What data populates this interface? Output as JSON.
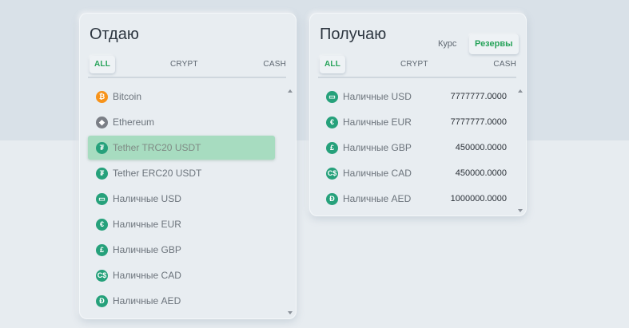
{
  "give": {
    "title": "Отдаю",
    "tabs": {
      "all": "ALL",
      "crypt": "CRYPT",
      "cash": "CASH"
    },
    "items": [
      {
        "label": "Bitcoin",
        "icon": "bitcoin-icon",
        "glyph": "₿",
        "color": "#f7931a"
      },
      {
        "label": "Ethereum",
        "icon": "ethereum-icon",
        "glyph": "◆",
        "color": "#7b7f86"
      },
      {
        "label": "Tether TRC20 USDT",
        "icon": "tether-icon",
        "glyph": "₮",
        "color": "#26a17b"
      },
      {
        "label": "Tether ERC20 USDT",
        "icon": "tether-icon",
        "glyph": "₮",
        "color": "#26a17b"
      },
      {
        "label": "Наличные USD",
        "icon": "cash-usd-icon",
        "glyph": "▭",
        "color": "#26a17b"
      },
      {
        "label": "Наличные EUR",
        "icon": "cash-eur-icon",
        "glyph": "€",
        "color": "#26a17b"
      },
      {
        "label": "Наличные GBP",
        "icon": "cash-gbp-icon",
        "glyph": "£",
        "color": "#26a17b"
      },
      {
        "label": "Наличные CAD",
        "icon": "cash-cad-icon",
        "glyph": "C$",
        "color": "#26a17b"
      },
      {
        "label": "Наличные AED",
        "icon": "cash-aed-icon",
        "glyph": "Đ",
        "color": "#26a17b"
      }
    ],
    "selected_index": 2
  },
  "get": {
    "title": "Получаю",
    "rate_label": "Курс",
    "reserves_label": "Резервы",
    "tabs": {
      "all": "ALL",
      "crypt": "CRYPT",
      "cash": "CASH"
    },
    "items": [
      {
        "label": "Наличные USD",
        "amount": "7777777.0000",
        "icon": "cash-usd-icon",
        "glyph": "▭",
        "color": "#26a17b"
      },
      {
        "label": "Наличные EUR",
        "amount": "7777777.0000",
        "icon": "cash-eur-icon",
        "glyph": "€",
        "color": "#26a17b"
      },
      {
        "label": "Наличные GBP",
        "amount": "450000.0000",
        "icon": "cash-gbp-icon",
        "glyph": "£",
        "color": "#26a17b"
      },
      {
        "label": "Наличные CAD",
        "amount": "450000.0000",
        "icon": "cash-cad-icon",
        "glyph": "C$",
        "color": "#26a17b"
      },
      {
        "label": "Наличные AED",
        "amount": "1000000.0000",
        "icon": "cash-aed-icon",
        "glyph": "Đ",
        "color": "#26a17b"
      }
    ]
  }
}
